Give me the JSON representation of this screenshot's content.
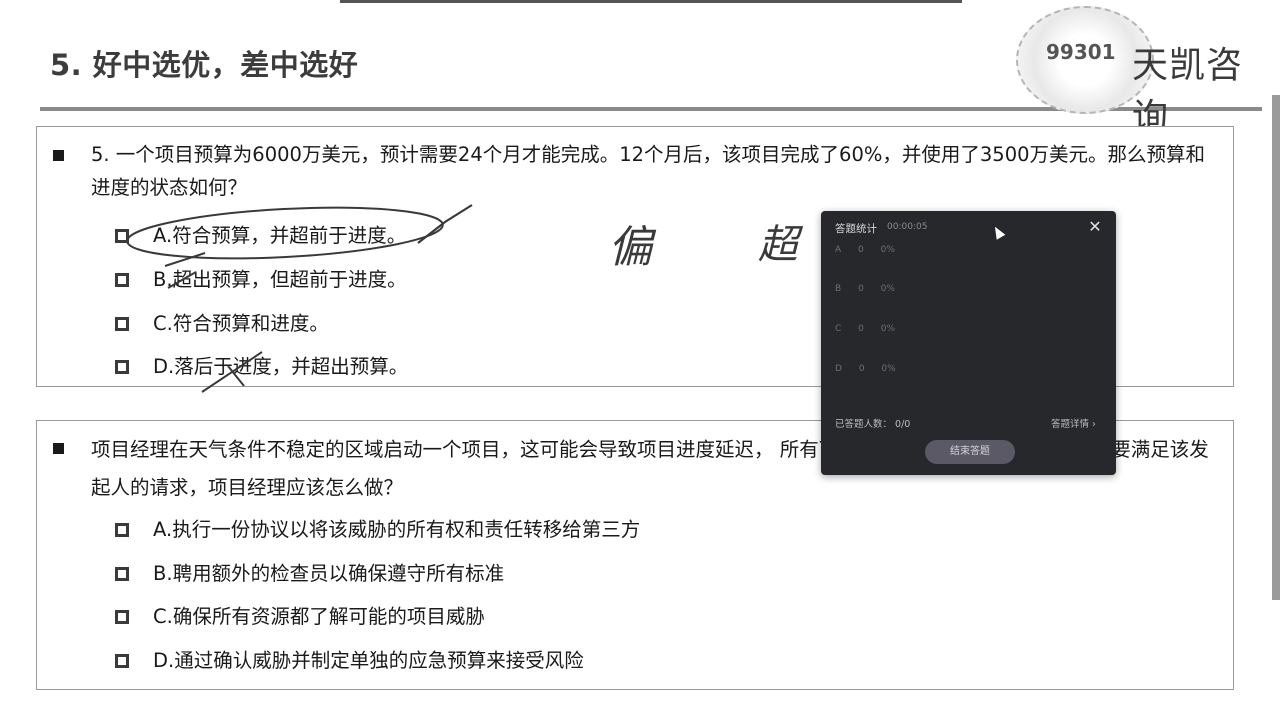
{
  "slide": {
    "title": "5. 好中选优，差中选好"
  },
  "logo": {
    "number": "99301",
    "text": "天凯咨询"
  },
  "question1": {
    "text": "5. 一个项目预算为6000万美元，预计需要24个月才能完成。12个月后，该项目完成了60%，并使用了3500万美元。那么预算和进度的状态如何？",
    "options": [
      "A.符合预算，并超前于进度。",
      "B.超出预算，但超前于进度。",
      "C.符合预算和进度。",
      "D.落后于进度，并超出预算。"
    ]
  },
  "question2": {
    "text": "项目经理在天气条件不稳定的区域启动一个项目，这可能会导致项目进度延迟，                                        所有可能的威胁，以避免延迟处罚，若要满足该发起人的请求，项目经理应该怎么做？",
    "options": [
      "A.执行一份协议以将该威胁的所有权和责任转移给第三方",
      "B.聘用额外的检查员以确保遵守所有标准",
      "C.确保所有资源都了解可能的项目威胁",
      "D.通过确认威胁并制定单独的应急预算来接受风险"
    ]
  },
  "annotations": {
    "handwriting_1": "偏",
    "handwriting_2": "超"
  },
  "popup": {
    "header": "答题统计",
    "timer": "00:00:05",
    "rows": [
      {
        "label": "A",
        "count": "0",
        "pct": "0%"
      },
      {
        "label": "B",
        "count": "0",
        "pct": "0%"
      },
      {
        "label": "C",
        "count": "0",
        "pct": "0%"
      },
      {
        "label": "D",
        "count": "0",
        "pct": "0%"
      }
    ],
    "answered_label": "已答题人数：",
    "answered_value": "0/0",
    "details_link": "答题详情 ›",
    "end_button": "结束答题",
    "close_icon": "close-icon"
  },
  "colors": {
    "popup_bg": "#27282c",
    "title_color": "#3c3c3c",
    "ink": "#3a3a3a"
  }
}
